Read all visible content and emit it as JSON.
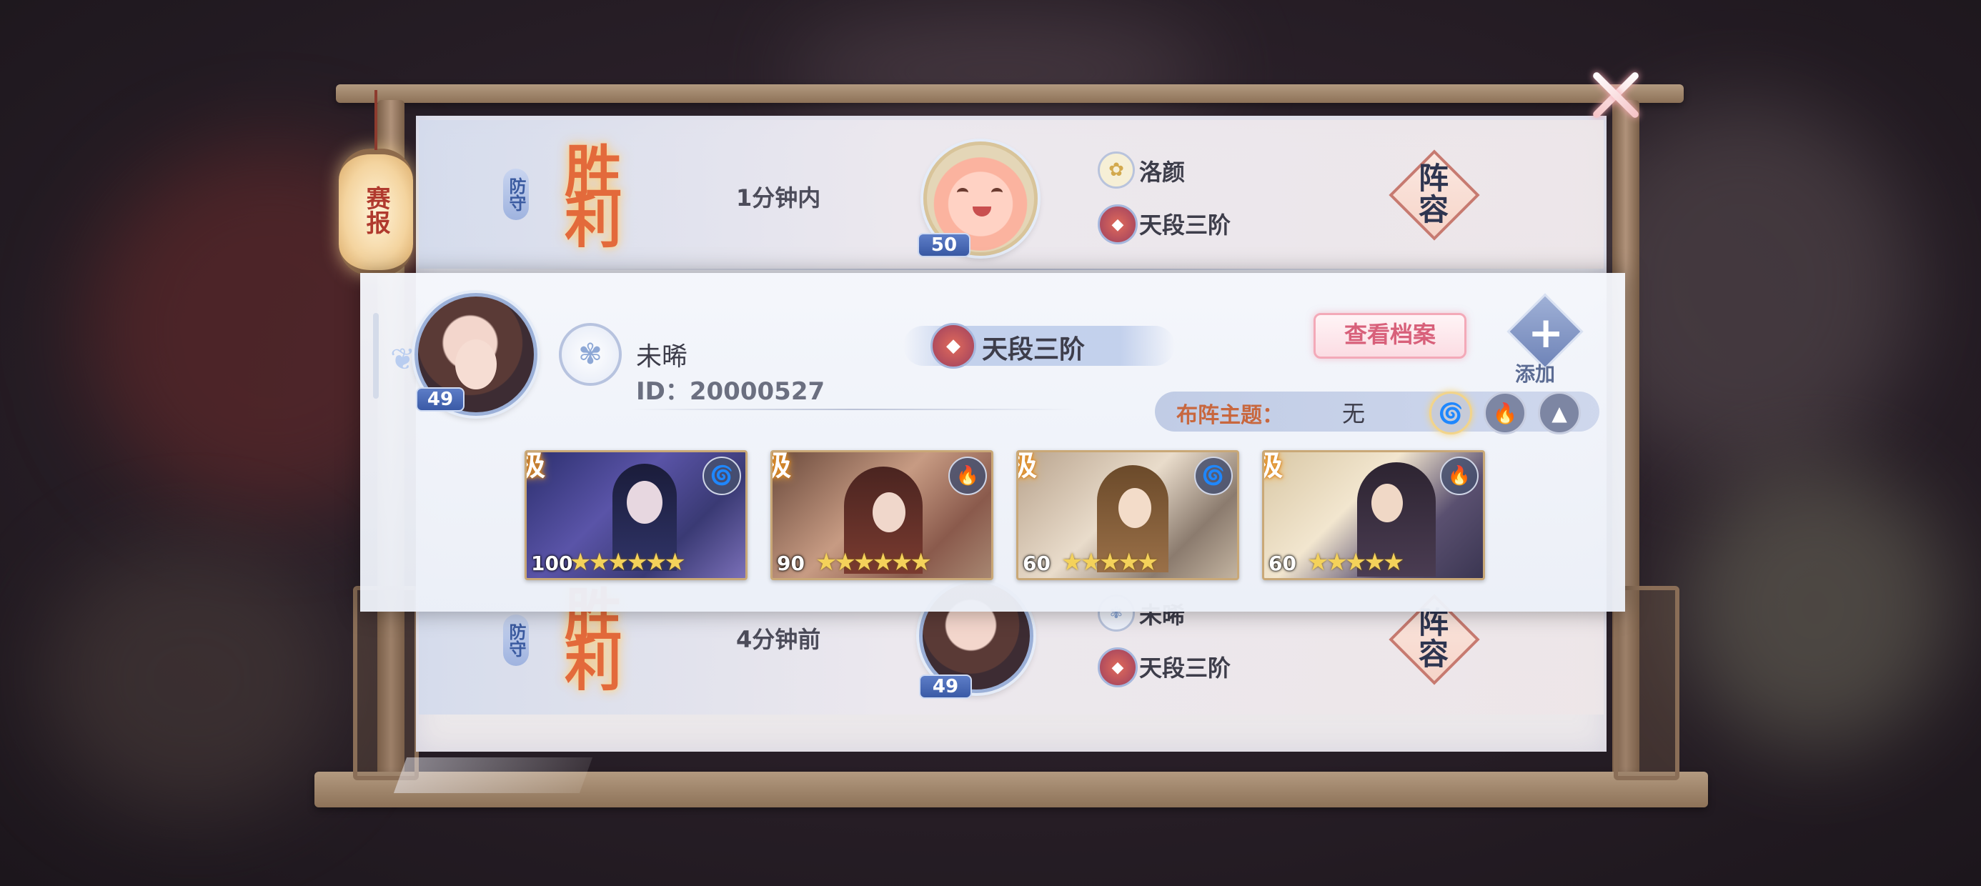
{
  "report_lantern": "赛报",
  "matches": [
    {
      "side_tag": "防守",
      "result": "胜利",
      "time": "1分钟内",
      "level": "50",
      "opponent_name": "洛颜",
      "opponent_rank": "天段三阶",
      "lineup_label": "阵容"
    },
    {
      "side_tag": "防守",
      "result": "胜利",
      "time": "4分钟前",
      "level": "49",
      "opponent_name": "未晞",
      "opponent_rank": "天段三阶",
      "lineup_label": "阵容"
    }
  ],
  "popup": {
    "avatar_level": "49",
    "player_name": "未晞",
    "player_id": "ID：20000527",
    "rank": "天段三阶",
    "view_profile_label": "查看档案",
    "add_label": "添加",
    "theme_label": "布阵主题：",
    "theme_value": "无",
    "cards": [
      {
        "grade": "极",
        "level": "100",
        "element": "wind"
      },
      {
        "grade": "极",
        "level": "90",
        "element": "fire"
      },
      {
        "grade": "极",
        "level": "60",
        "element": "wind"
      },
      {
        "grade": "极",
        "level": "60",
        "element": "fire"
      }
    ]
  },
  "colors": {
    "accent_pink": "#d8607a",
    "victory_orange": "#e36a3b",
    "level_blue": "#3a5aa6"
  }
}
